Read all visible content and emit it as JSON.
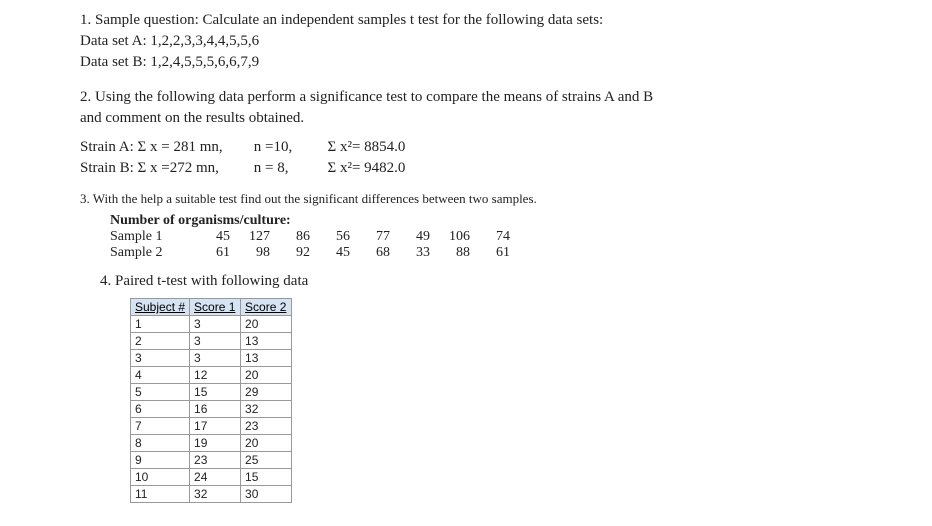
{
  "q1": {
    "prompt": "1. Sample question: Calculate an independent samples t test for the following data sets:",
    "dataA": "Data set A: 1,2,2,3,3,4,4,5,5,6",
    "dataB": "Data set B: 1,2,4,5,5,5,6,6,7,9"
  },
  "q2": {
    "prompt1": "2. Using the following data perform a significance test to compare the means  of strains A and B",
    "prompt2": "and comment on the results obtained.",
    "strainA": {
      "c1": "Strain A: Σ x = 281 mn,",
      "c2": "n =10,",
      "c3": "Σ x²= 8854.0"
    },
    "strainB": {
      "c1": "Strain B:  Σ x =272 mn,",
      "c2": "n = 8,",
      "c3": "Σ x²= 9482.0"
    }
  },
  "q3": {
    "prompt": "3.  With the help a suitable test find out the significant differences between two samples.",
    "sub_heading": "Number of organisms/culture:",
    "sample1_label": "Sample 1",
    "sample2_label": "Sample 2",
    "sample1": [
      "45",
      "127",
      "86",
      "56",
      "77",
      "49",
      "106",
      "74"
    ],
    "sample2": [
      "61",
      "98",
      "92",
      "45",
      "68",
      "33",
      "88",
      "61"
    ]
  },
  "q4": {
    "prompt": "4. Paired t-test with following data",
    "headers": [
      "Subject #",
      "Score 1",
      "Score 2"
    ],
    "rows": [
      [
        "1",
        "3",
        "20"
      ],
      [
        "2",
        "3",
        "13"
      ],
      [
        "3",
        "3",
        "13"
      ],
      [
        "4",
        "12",
        "20"
      ],
      [
        "5",
        "15",
        "29"
      ],
      [
        "6",
        "16",
        "32"
      ],
      [
        "7",
        "17",
        "23"
      ],
      [
        "8",
        "19",
        "20"
      ],
      [
        "9",
        "23",
        "25"
      ],
      [
        "10",
        "24",
        "15"
      ],
      [
        "11",
        "32",
        "30"
      ]
    ]
  }
}
